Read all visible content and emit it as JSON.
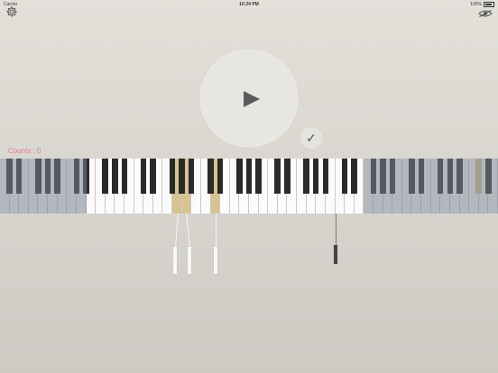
{
  "status_bar": {
    "carrier": "Carrier",
    "time": "10:24 PM",
    "battery": "100%"
  },
  "icons": {
    "settings": "gear-icon",
    "view": "eye-icon",
    "play": "play-icon",
    "check": "check-icon"
  },
  "check_button": {
    "glyph": "✓"
  },
  "counts": {
    "label": "Counts : 0"
  },
  "keyboard": {
    "highlighted_white_keys": [
      18,
      19,
      22
    ],
    "highlighted_black_keys": [
      35
    ],
    "dimmed_left_end_key": 9,
    "dimmed_right_start_key": 38,
    "total_white_keys": 52
  },
  "colors": {
    "highlight": "#d8c38f",
    "counts_text": "#e07a8e",
    "background": "#dcd9d3"
  }
}
